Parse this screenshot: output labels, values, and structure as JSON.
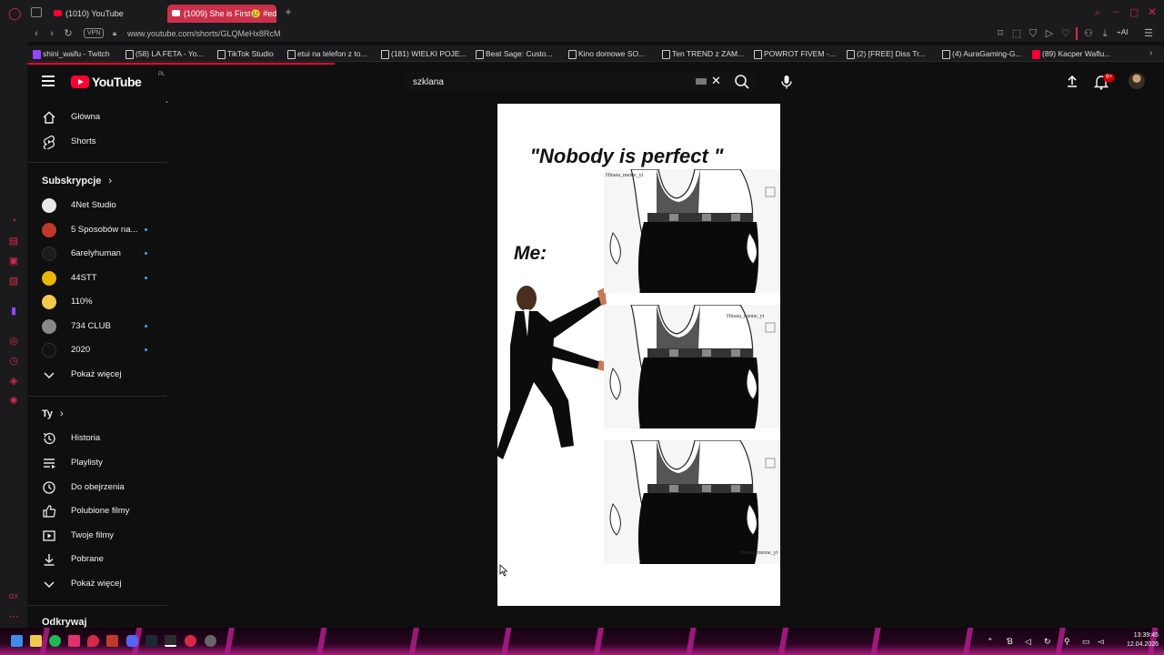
{
  "browser": {
    "tabs": [
      {
        "label": "(1010) YouTube",
        "active": false
      },
      {
        "label": "(1009) She is First😢 #ed",
        "active": true
      }
    ],
    "new_tab": "+",
    "vpn": "VPN",
    "url": "www.youtube.com/shorts/GLQMeHx8RcM",
    "bookmarks": [
      {
        "label": "shini_waifu - Twitch",
        "icon": "twitch-icon"
      },
      {
        "label": "(58) LA FETA - Yo...",
        "icon": "page-icon"
      },
      {
        "label": "TikTok Studio",
        "icon": "page-icon"
      },
      {
        "label": "etui na telefon z to...",
        "icon": "page-icon"
      },
      {
        "label": "(181) WIELKI POJE...",
        "icon": "page-icon"
      },
      {
        "label": "Beat Sage: Custo...",
        "icon": "page-icon"
      },
      {
        "label": "Kino domowe SO...",
        "icon": "page-icon"
      },
      {
        "label": "Ten TREND z ZAM...",
        "icon": "page-icon"
      },
      {
        "label": "POWROT FIVEM -...",
        "icon": "page-icon"
      },
      {
        "label": "(2) [FREE] Diss Tr...",
        "icon": "page-icon"
      },
      {
        "label": "(4) AuraGaming-G...",
        "icon": "page-icon"
      },
      {
        "label": "(89) Kacper Waflu...",
        "icon": "youtube-icon"
      }
    ],
    "toolbar_ai": "AI"
  },
  "youtube": {
    "logo": "YouTube",
    "country_code": "PL",
    "search": {
      "value": "szklana",
      "clear": "✕"
    },
    "notification_badge": "9+",
    "guide": {
      "main": [
        {
          "label": "Główna",
          "icon": "home-icon"
        },
        {
          "label": "Shorts",
          "icon": "shorts-icon"
        }
      ],
      "subscriptions_title": "Subskrypcje",
      "subscriptions": [
        {
          "label": "4Net Studio",
          "new": false,
          "color": "#e8e8e8"
        },
        {
          "label": "5 Sposobów na...",
          "new": true,
          "color": "#c0392b"
        },
        {
          "label": "6arelyhuman",
          "new": true,
          "color": "#1b1b1b"
        },
        {
          "label": "44STT",
          "new": true,
          "color": "#e6b800"
        },
        {
          "label": "110%",
          "new": false,
          "color": "#f2c94c"
        },
        {
          "label": "734 CLUB",
          "new": true,
          "color": "#888888"
        },
        {
          "label": "2020",
          "new": true,
          "color": "#111111"
        }
      ],
      "show_more_1": "Pokaż więcej",
      "you_title": "Ty",
      "you": [
        {
          "label": "Historia",
          "icon": "history-icon"
        },
        {
          "label": "Playlisty",
          "icon": "playlists-icon"
        },
        {
          "label": "Do obejrzenia",
          "icon": "watch-later-icon"
        },
        {
          "label": "Polubione filmy",
          "icon": "like-icon"
        },
        {
          "label": "Twoje filmy",
          "icon": "your-videos-icon"
        },
        {
          "label": "Pobrane",
          "icon": "download-icon"
        }
      ],
      "show_more_2": "Pokaż więcej",
      "explore_title": "Odkrywaj"
    },
    "short": {
      "title_text": "\"Nobody is perfect \"",
      "me_text": "Me:",
      "watermark": "Hinata_meme_yt"
    }
  },
  "taskbar": {
    "time": "13:39:45",
    "date": "12.04.2026"
  },
  "colors": {
    "youtube_red": "#ff0033",
    "opera_red": "#d8284a",
    "active_tab": "#c9304a",
    "subscribed_dot": "#3ea6ff"
  }
}
